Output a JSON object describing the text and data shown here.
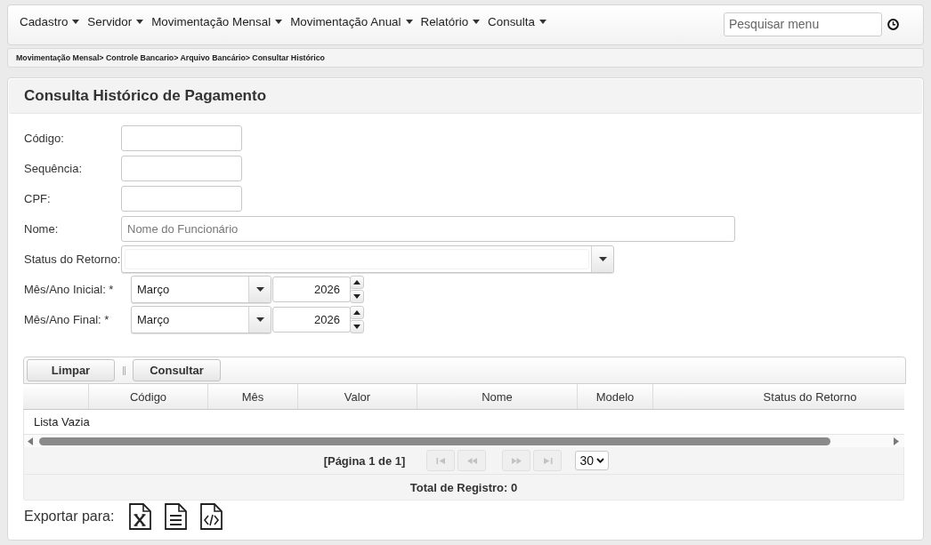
{
  "menu": {
    "items": [
      {
        "label": "Cadastro"
      },
      {
        "label": "Servidor"
      },
      {
        "label": "Movimentação Mensal"
      },
      {
        "label": "Movimentação Anual"
      },
      {
        "label": "Relatório"
      },
      {
        "label": "Consulta"
      }
    ],
    "search": {
      "placeholder": "Pesquisar menu"
    }
  },
  "breadcrumb": "Movimentação Mensal> Controle Bancario> Arquivo Bancário> Consultar Histórico",
  "panel": {
    "title": "Consulta Histórico de Pagamento",
    "fields": [
      {
        "kind": "text",
        "label": "Código:"
      },
      {
        "kind": "text",
        "label": "Sequência:"
      },
      {
        "kind": "text",
        "label": "CPF:"
      },
      {
        "kind": "long_text",
        "label": "Nome:",
        "placeholder": "Nome do Funcionário"
      },
      {
        "kind": "dropdown",
        "label": "Status do Retorno:"
      },
      {
        "kind": "month_year",
        "label": "Mês/Ano Inicial: *",
        "month": "Março",
        "year": "2026"
      },
      {
        "kind": "month_year",
        "label": "Mês/Ano Final: *",
        "month": "Março",
        "year": "2026"
      }
    ],
    "toolbar": {
      "buttons": [
        {
          "label": "Limpar"
        },
        {
          "label": "Consultar"
        }
      ]
    },
    "table": {
      "columns": [
        {
          "kind": "blank"
        },
        {
          "kind": "text",
          "label": "Código"
        },
        {
          "kind": "text",
          "label": "Mês"
        },
        {
          "kind": "text",
          "label": "Valor"
        },
        {
          "kind": "text",
          "label": "Nome"
        },
        {
          "kind": "text",
          "label": "Modelo"
        },
        {
          "kind": "text",
          "label": "Status do Retorno"
        }
      ],
      "empty_message": "Lista Vazia"
    },
    "pager": {
      "page_label": "[Página 1 de 1]",
      "nav_buttons": [
        {
          "kind": "first",
          "disabled": true
        },
        {
          "kind": "previous",
          "disabled": true
        },
        {
          "kind": "next",
          "disabled": true
        },
        {
          "kind": "last",
          "disabled": true
        }
      ],
      "page_size": "30"
    },
    "total": "Total de Registro: 0",
    "export": {
      "label": "Exportar para:"
    }
  }
}
